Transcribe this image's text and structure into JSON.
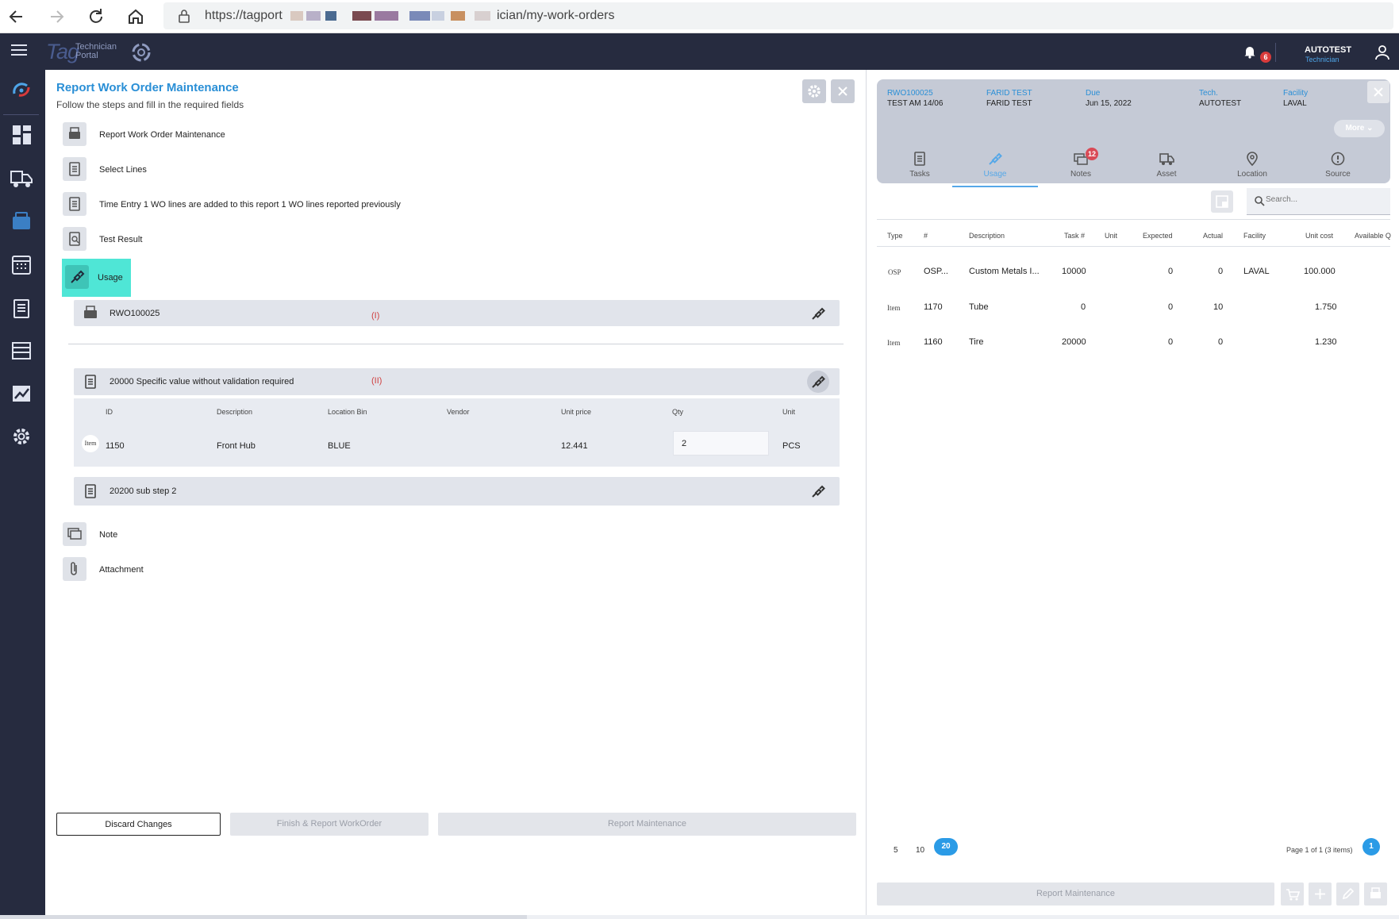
{
  "browser": {
    "url_start": "https://tagport",
    "url_end": "ician/my-work-orders"
  },
  "header": {
    "logo_main": "Tag",
    "logo_sub_1": "Technician",
    "logo_sub_2": "Portal",
    "notifications_count": "6",
    "user_name": "AUTOTEST",
    "user_role": "Technician"
  },
  "left": {
    "title": "Report Work Order Maintenance",
    "subtitle": "Follow the steps and fill in the required fields",
    "steps": [
      {
        "label": "Report Work Order Maintenance"
      },
      {
        "label": "Select Lines"
      },
      {
        "label": "Time Entry    1 WO lines are added to this report 1 WO lines reported previously"
      },
      {
        "label": "Test Result"
      },
      {
        "label": "Usage"
      },
      {
        "label": "Note"
      },
      {
        "label": "Attachment"
      }
    ],
    "usage_rows": [
      {
        "title": "RWO100025",
        "mark": "(I)"
      },
      {
        "title": "20000  Specific value without validation required",
        "mark": "(II)"
      },
      {
        "title": "20200  sub step 2",
        "mark": ""
      }
    ],
    "sub_table": {
      "headers": [
        "ID",
        "Description",
        "Location  Bin",
        "Vendor",
        "Unit price",
        "Qty",
        "Unit"
      ],
      "row": {
        "type_icon": "Item",
        "id": "1150",
        "description": "Front Hub",
        "location": "BLUE",
        "vendor": "",
        "unit_price": "12.441",
        "qty": "2",
        "unit": "PCS"
      }
    },
    "footer": {
      "discard": "Discard Changes",
      "finish": "Finish & Report WorkOrder",
      "report": "Report Maintenance"
    }
  },
  "right": {
    "card": {
      "wo_id": "RWO100025",
      "wo_desc": "TEST AM 14/06",
      "customer_key": "FARID TEST",
      "customer_value": "FARID TEST",
      "due_key": "Due",
      "due_value": "Jun 15, 2022",
      "tech_key": "Tech.",
      "tech_value": "AUTOTEST",
      "facility_key": "Facility",
      "facility_value": "LAVAL",
      "more": "More"
    },
    "tabs": [
      {
        "label": "Tasks"
      },
      {
        "label": "Usage"
      },
      {
        "label": "Notes",
        "badge": "12"
      },
      {
        "label": "Asset"
      },
      {
        "label": "Location"
      },
      {
        "label": "Source"
      }
    ],
    "search_placeholder": "Search...",
    "table": {
      "headers": [
        "Type",
        "#",
        "Description",
        "Task #",
        "Unit",
        "Expected",
        "Actual",
        "Facility",
        "Unit cost",
        "Available Q"
      ],
      "rows": [
        {
          "type": "OSP",
          "num": "OSP...",
          "description": "Custom Metals I...",
          "task": "10000",
          "unit": "",
          "expected": "0",
          "actual": "0",
          "facility": "LAVAL",
          "unit_cost": "100.000"
        },
        {
          "type": "Item",
          "num": "1170",
          "description": "Tube",
          "task": "0",
          "unit": "",
          "expected": "0",
          "actual": "10",
          "facility": "",
          "unit_cost": "1.750"
        },
        {
          "type": "Item",
          "num": "1160",
          "description": "Tire",
          "task": "20000",
          "unit": "",
          "expected": "0",
          "actual": "0",
          "facility": "",
          "unit_cost": "1.230"
        }
      ]
    },
    "pager": {
      "sizes": [
        "5",
        "10",
        "20"
      ],
      "info": "Page 1 of 1 (3 items)",
      "page": "1"
    },
    "footer_report": "Report Maintenance"
  },
  "colors": {
    "topbar": "#262b3f",
    "accent": "#2a8fd6",
    "active_step": "#4fe6d6",
    "badge": "#d83b3b"
  }
}
